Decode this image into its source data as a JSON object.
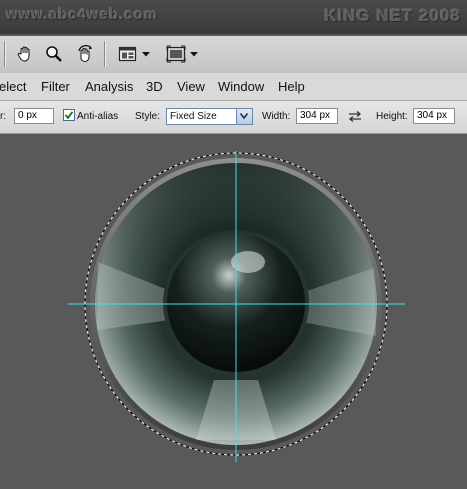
{
  "watermark": {
    "site": "www.abc4web.com",
    "signature": "KING NET 2008"
  },
  "toolbar": {
    "icons": [
      "hand-tool-icon",
      "zoom-tool-icon",
      "rotate-view-icon",
      "arrange-documents-icon",
      "screen-mode-icon"
    ]
  },
  "menu": {
    "items": [
      "elect",
      "Filter",
      "Analysis",
      "3D",
      "View",
      "Window",
      "Help"
    ]
  },
  "options": {
    "feather_label": "r:",
    "feather_value": "0 px",
    "antialias_label": "Anti-alias",
    "antialias_checked": true,
    "style_label": "Style:",
    "style_value": "Fixed Size",
    "width_label": "Width:",
    "width_value": "304 px",
    "height_label": "Height:",
    "height_value": "304 px"
  },
  "colors": {
    "canvas_bg": "#595959",
    "guide": "#3fe0e6",
    "ring_dark": "#1c2a27",
    "ring_light": "#b9c6c2"
  }
}
